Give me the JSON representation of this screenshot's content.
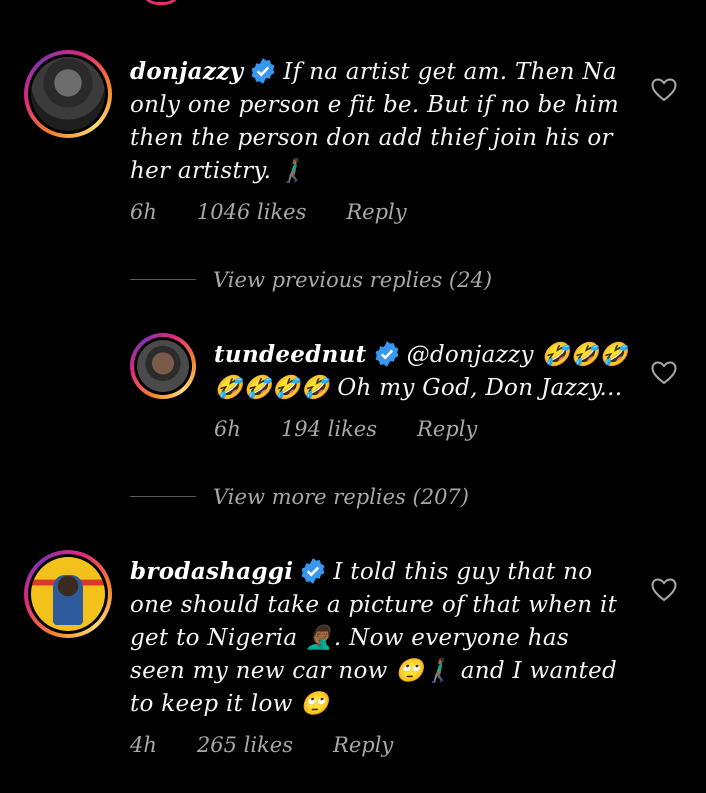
{
  "comments": [
    {
      "username": "donjazzy",
      "text": "If na artist get am. Then Na only one person e fit be. But if no be him then the person don add thief join his or her artistry. 🚶🏾‍♂️",
      "time": "6h",
      "likes": "1046 likes",
      "reply": "Reply"
    },
    {
      "username": "tundeednut",
      "text": "@donjazzy 🤣🤣🤣🤣🤣🤣🤣 Oh my God, Don Jazzy...",
      "time": "6h",
      "likes": "194 likes",
      "reply": "Reply"
    },
    {
      "username": "brodashaggi",
      "text": "I told this guy that no one should take a picture of that when it get to Nigeria 🤦🏾‍♂️. Now everyone has seen my new car now 🙄🚶🏾‍♂️ and I wanted to keep it low 🙄",
      "time": "4h",
      "likes": "265 likes",
      "reply": "Reply"
    }
  ],
  "view_previous_replies": "View previous replies (24)",
  "view_more_replies": "View more replies (207)",
  "colors": {
    "background": "#000000",
    "verified_badge": "#3897f0",
    "muted_text": "#a8a8a8"
  }
}
